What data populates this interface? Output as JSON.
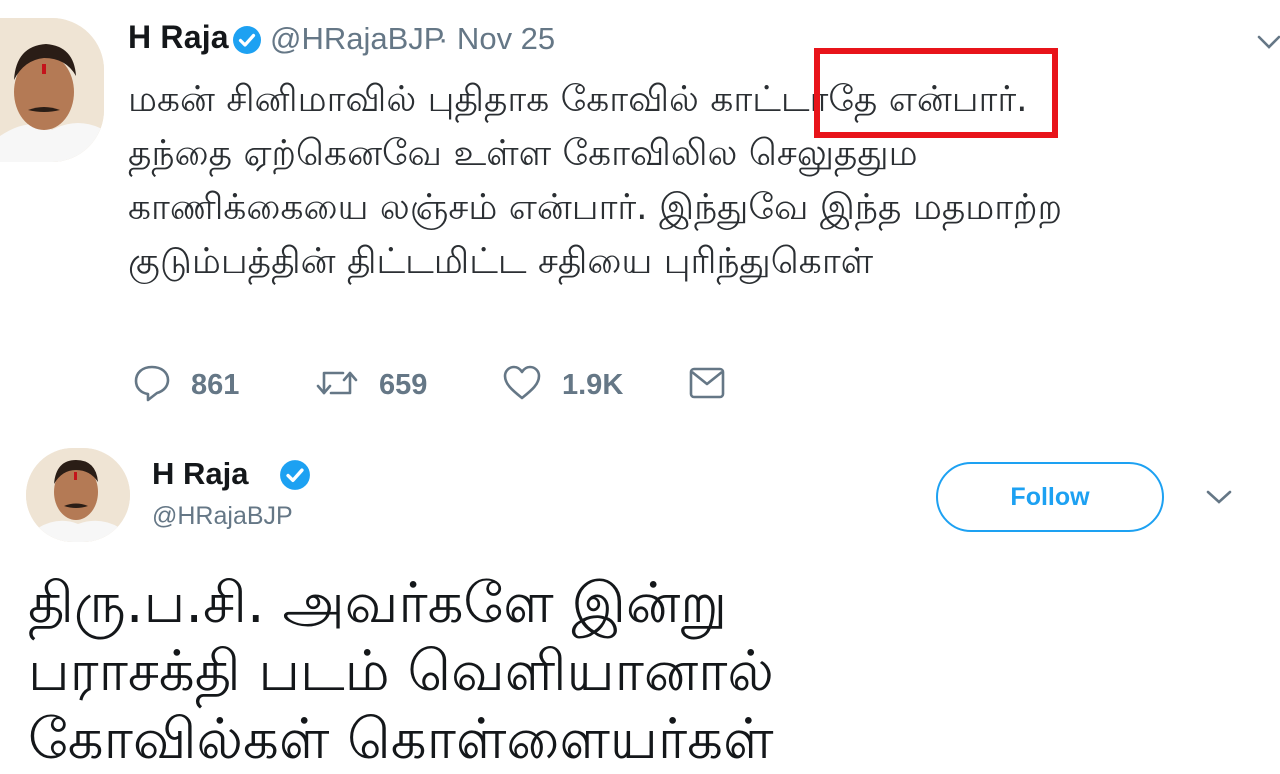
{
  "tweet1": {
    "author_name": "H Raja",
    "handle": "@HRajaBJP",
    "date": "· Nov 25",
    "lines": [
      "மகன் சினிமாவில் புதிதாக கோவில் காட்டாதே என்பார்.",
      "தந்தை ஏற்கெனவே உள்ள கோவிலில செலுததும",
      "காணிக்கையை லஞ்சம் என்பார். இந்துவே இந்த மதமாற்ற",
      "குடும்பத்தின் திட்டமிட்ட சதியை புரிந்துகொள்"
    ],
    "highlighted_word": "காட்டாதே",
    "actions": {
      "reply_count": "861",
      "retweet_count": "659",
      "like_count": "1.9K"
    },
    "icons": [
      "avatar",
      "verified-icon",
      "chevron-down-icon",
      "reply-icon",
      "retweet-icon",
      "like-icon",
      "direct-message-icon"
    ]
  },
  "tweet2": {
    "author_name": "H Raja",
    "handle": "@HRajaBJP",
    "follow_label": "Follow",
    "lines": [
      "திரு.ப.சி. அவர்களே இன்று",
      "பராசக்தி படம் வெளியானால்",
      "கோவில்கள் கொள்ளையர்கள்"
    ],
    "icons": [
      "avatar",
      "verified-icon",
      "chevron-down-icon"
    ]
  },
  "colors": {
    "twitter_blue": "#1da1f2",
    "highlight_red": "#e8141a",
    "secondary_text": "#657786"
  }
}
